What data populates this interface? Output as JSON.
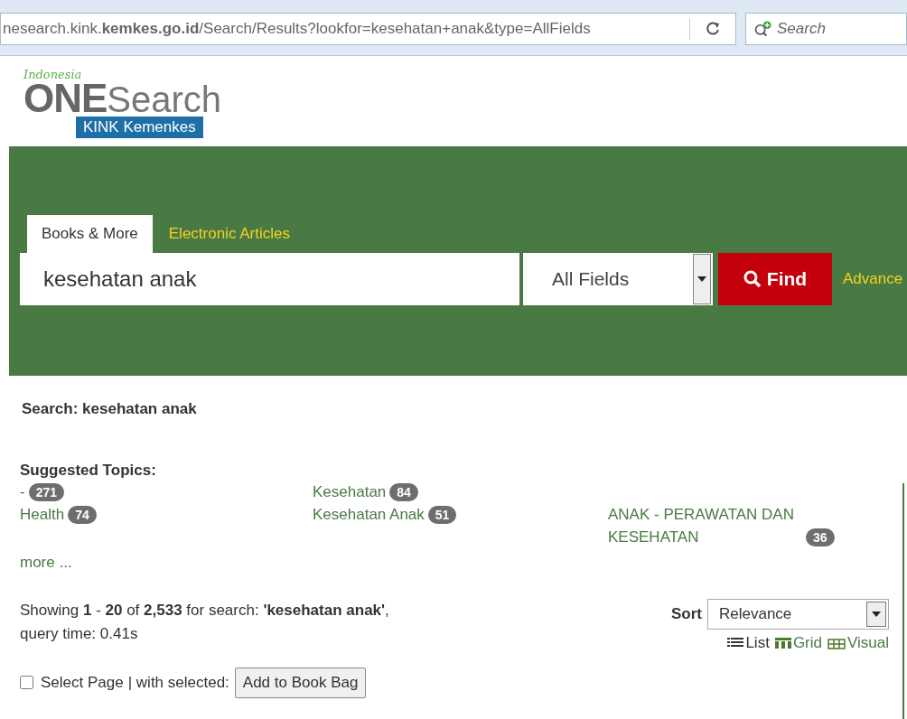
{
  "browser": {
    "url": "nesearch.kink.**kemkes.go.id**/Search/Results?lookfor=kesehatan+anak&type=AllFields",
    "search_placeholder": "Search"
  },
  "logo": {
    "tagline": "Indonesia",
    "name_bold": "ONE",
    "name_light": "Search",
    "badge": "KINK Kemenkes"
  },
  "tabs": [
    {
      "label": "Books & More",
      "selected": true
    },
    {
      "label": "Electronic Articles",
      "selected": false
    }
  ],
  "search": {
    "value": "kesehatan anak",
    "field_type": "All Fields",
    "button": "Find",
    "advanced": "Advance"
  },
  "search_heading": "Search: kesehatan anak",
  "suggested_topics": {
    "title": "Suggested Topics:",
    "rows": [
      [
        {
          "label": "-",
          "count": "271"
        },
        {
          "label": "Kesehatan",
          "count": "84"
        }
      ],
      [
        {
          "label": "Health",
          "count": "74"
        },
        {
          "label": "Kesehatan Anak",
          "count": "51"
        },
        {
          "label": "ANAK - PERAWATAN DAN KESEHATAN",
          "count": "36"
        }
      ]
    ],
    "more": "more ..."
  },
  "results": {
    "summary": "Showing **1** - **20** of **2,533** for search: **'kesehatan anak'**,",
    "query_time": "query time: 0.41s"
  },
  "sort": {
    "label": "Sort",
    "value": "Relevance"
  },
  "views": [
    {
      "kind": "list",
      "label": "List",
      "selected": true
    },
    {
      "kind": "grid",
      "label": "Grid",
      "selected": false
    },
    {
      "kind": "visual",
      "label": "Visual",
      "selected": false
    }
  ],
  "bulk": {
    "select_page": "Select Page",
    "checked": false,
    "with_selected": "| with selected:",
    "button": "Add to Book Bag"
  }
}
